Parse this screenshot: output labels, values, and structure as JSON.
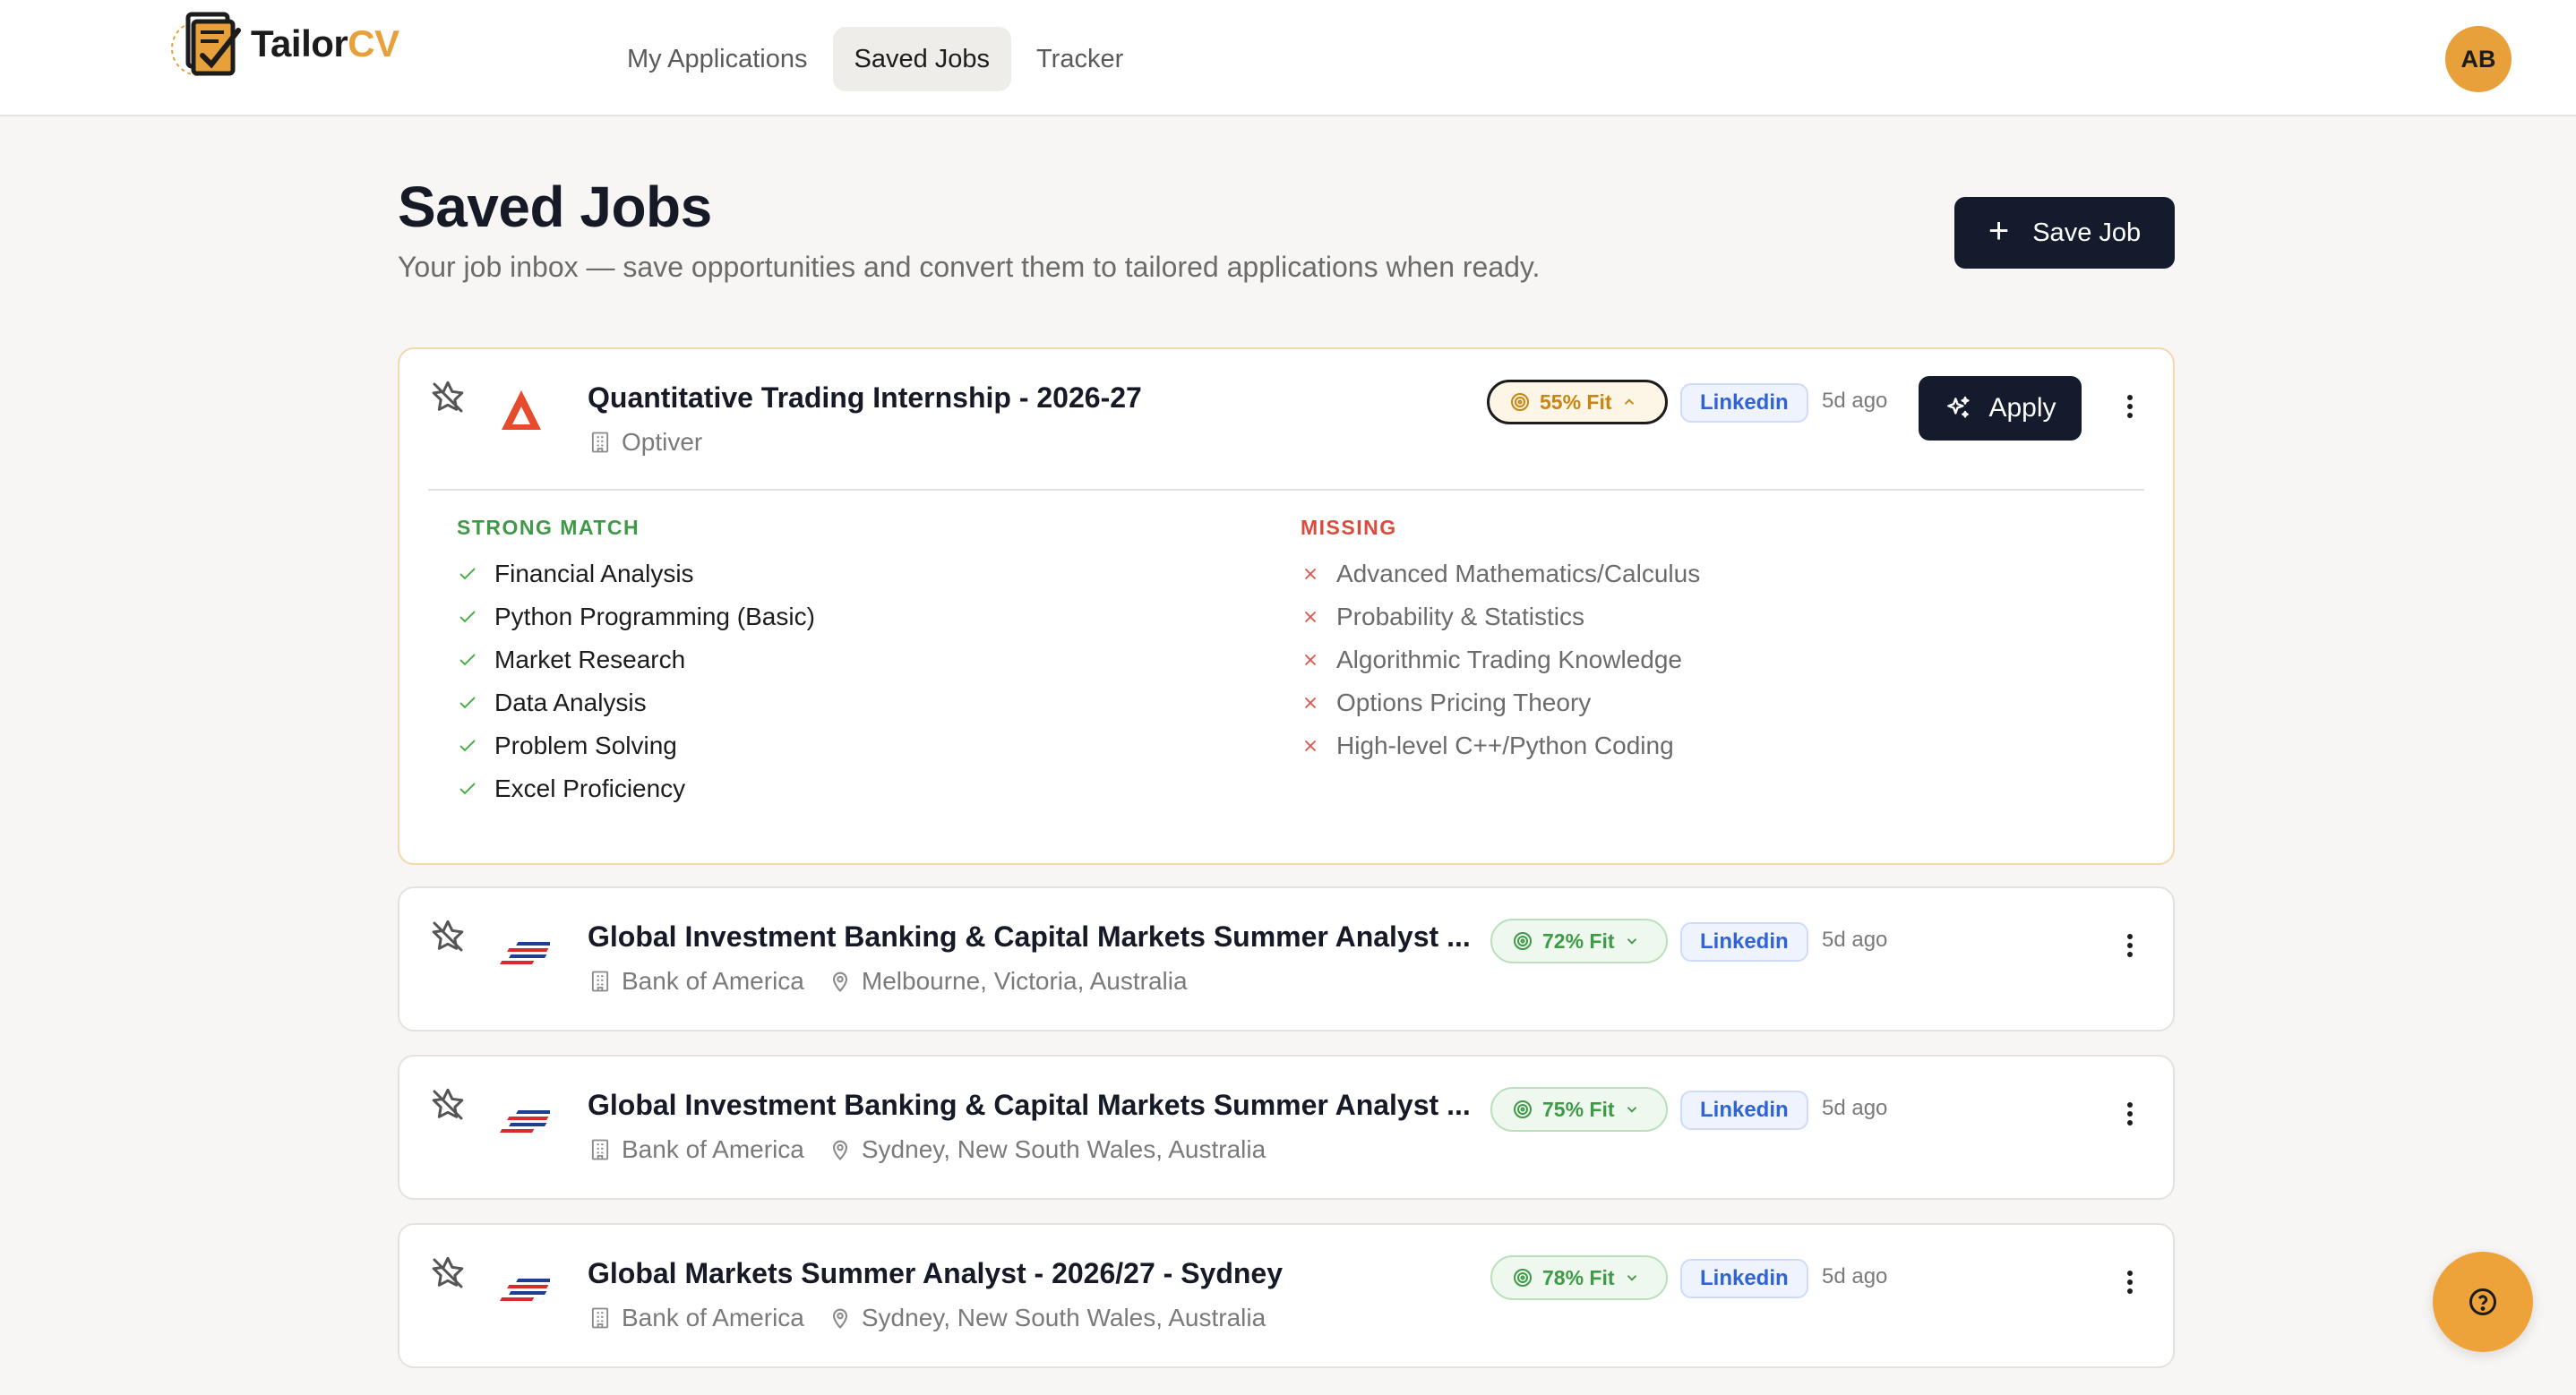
{
  "brand": {
    "name_part1": "Tailor",
    "name_part2": "CV",
    "accent": "#e8a03a"
  },
  "nav": {
    "items": [
      "My Applications",
      "Saved Jobs",
      "Tracker"
    ],
    "active": "Saved Jobs"
  },
  "user": {
    "initials": "AB"
  },
  "page": {
    "title": "Saved Jobs",
    "subtitle": "Your job inbox — save opportunities and convert them to tailored applications when ready.",
    "save_button": "Save Job"
  },
  "jobs": [
    {
      "title": "Quantitative Trading Internship - 2026-27",
      "company": "Optiver",
      "location": "",
      "fit": "55% Fit",
      "source": "Linkedin",
      "ago": "5d ago",
      "apply_label": "Apply",
      "strong_match_label": "STRONG MATCH",
      "missing_label": "MISSING",
      "strong_match": [
        "Financial Analysis",
        "Python Programming (Basic)",
        "Market Research",
        "Data Analysis",
        "Problem Solving",
        "Excel Proficiency"
      ],
      "missing": [
        "Advanced Mathematics/Calculus",
        "Probability & Statistics",
        "Algorithmic Trading Knowledge",
        "Options Pricing Theory",
        "High-level C++/Python Coding"
      ]
    },
    {
      "title": "Global Investment Banking & Capital Markets Summer Analyst ...",
      "company": "Bank of America",
      "location": "Melbourne, Victoria, Australia",
      "fit": "72% Fit",
      "source": "Linkedin",
      "ago": "5d ago"
    },
    {
      "title": "Global Investment Banking & Capital Markets Summer Analyst ...",
      "company": "Bank of America",
      "location": "Sydney, New South Wales, Australia",
      "fit": "75% Fit",
      "source": "Linkedin",
      "ago": "5d ago"
    },
    {
      "title": "Global Markets Summer Analyst - 2026/27 - Sydney",
      "company": "Bank of America",
      "location": "Sydney, New South Wales, Australia",
      "fit": "78% Fit",
      "source": "Linkedin",
      "ago": "5d ago"
    }
  ]
}
